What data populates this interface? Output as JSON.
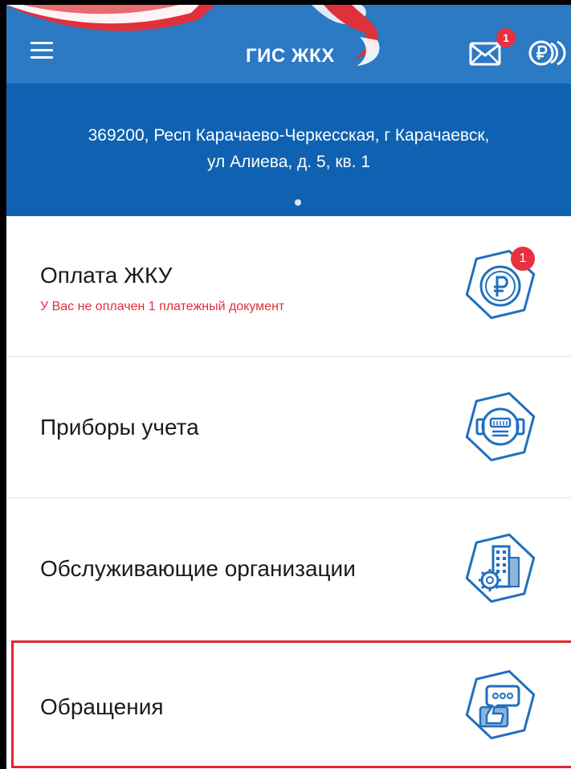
{
  "header": {
    "title": "ГИС ЖКХ",
    "mail_badge": "1",
    "colors": {
      "appbar": "#2c79c4",
      "address": "#0f62b2",
      "badge": "#e8303f"
    }
  },
  "address": {
    "line1": "369200, Респ Карачаево-Черкесская, г Карачаевск,",
    "line2": "ул Алиева, д. 5, кв. 1"
  },
  "menu": {
    "items": [
      {
        "label": "Оплата ЖКУ",
        "sub": "У Вас не оплачен 1 платежный документ",
        "badge": "1",
        "icon": "ruble-icon"
      },
      {
        "label": "Приборы учета",
        "icon": "meter-icon"
      },
      {
        "label": "Обслуживающие организации",
        "icon": "building-gear-icon"
      },
      {
        "label": "Обращения",
        "icon": "chat-like-icon"
      }
    ]
  }
}
